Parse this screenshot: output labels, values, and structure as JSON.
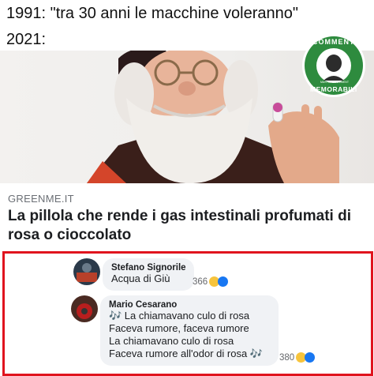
{
  "meme": {
    "line1": "1991: \"tra 30 anni le macchine voleranno\"",
    "line2": "2021:"
  },
  "article": {
    "source": "GREENME.IT",
    "headline": "La pillola che rende i gas intestinali profumati di rosa o cioccolato"
  },
  "logo": {
    "top_text": "COMMENTI",
    "bottom_text": "MEMORABILI",
    "small_text": "MASTERS COMMENT"
  },
  "comments": [
    {
      "author": "Stefano Signorile",
      "lines": [
        "Acqua di Giù"
      ],
      "reactions_count": "366",
      "reaction_icons": [
        "haha-icon",
        "like-icon"
      ]
    },
    {
      "author": "Mario Cesarano",
      "lines": [
        "🎶 La chiamavano culo di rosa",
        "Faceva rumore, faceva rumore",
        "La chiamavano culo di rosa",
        "Faceva rumore all'odor di rosa 🎶"
      ],
      "reactions_count": "380",
      "reaction_icons": [
        "haha-icon",
        "like-icon"
      ]
    }
  ],
  "colors": {
    "highlight_border": "#e0141e",
    "bubble": "#f0f2f5",
    "logo_green": "#2e8b3e"
  }
}
